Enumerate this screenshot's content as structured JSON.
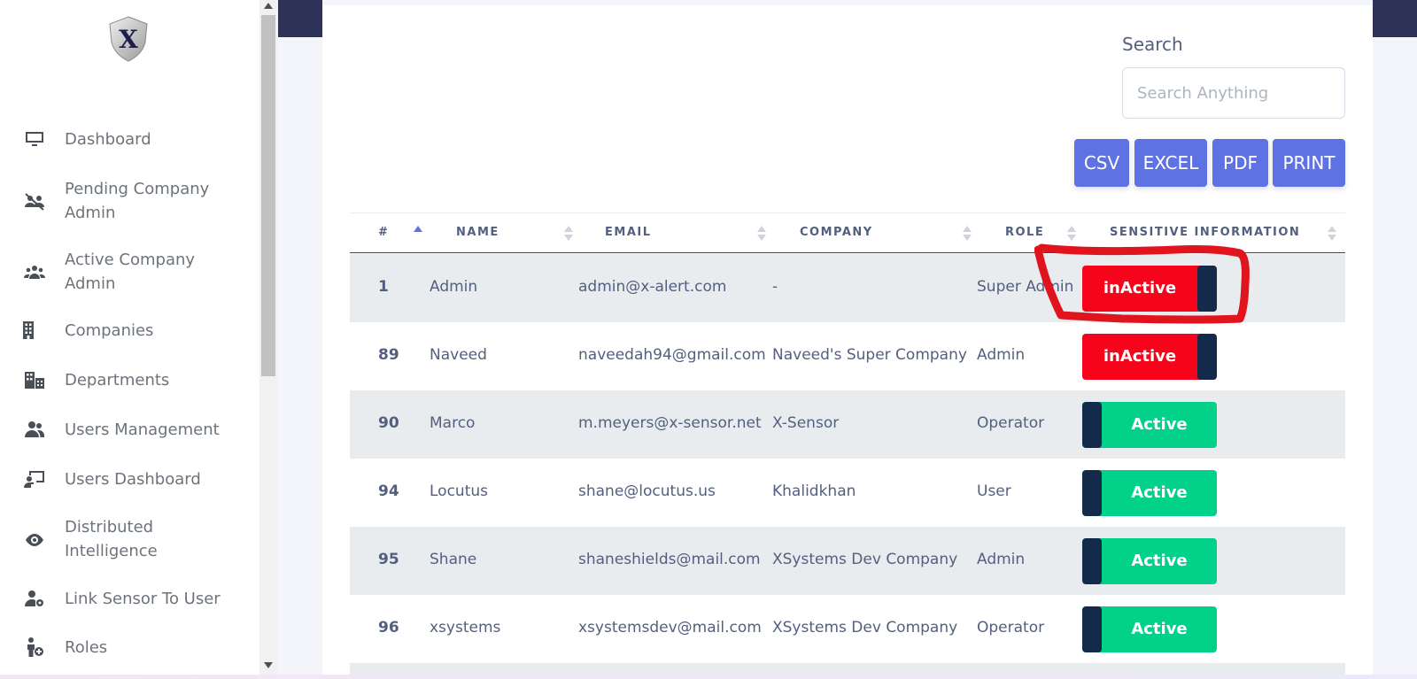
{
  "sidebar": {
    "logo_letter": "X",
    "items": [
      {
        "label": "Dashboard",
        "icon": "monitor-icon"
      },
      {
        "label": "Pending Company Admin",
        "icon": "users-slash-icon"
      },
      {
        "label": "Active Company Admin",
        "icon": "users-group-icon"
      },
      {
        "label": "Companies",
        "icon": "building-icon"
      },
      {
        "label": "Departments",
        "icon": "departments-icon"
      },
      {
        "label": "Users Management",
        "icon": "user-friends-icon"
      },
      {
        "label": "Users Dashboard",
        "icon": "chalkboard-user-icon"
      },
      {
        "label": "Distributed Intelligence",
        "icon": "eye-icon"
      },
      {
        "label": "Link Sensor To User",
        "icon": "user-cog-icon"
      },
      {
        "label": "Roles",
        "icon": "user-plus-icon"
      }
    ]
  },
  "search": {
    "label": "Search",
    "placeholder": "Search Anything",
    "value": ""
  },
  "export_buttons": [
    "CSV",
    "EXCEL",
    "PDF",
    "PRINT"
  ],
  "table": {
    "headers": [
      "#",
      "NAME",
      "EMAIL",
      "COMPANY",
      "ROLE",
      "SENSITIVE INFORMATION"
    ],
    "rows": [
      {
        "id": "1",
        "name": "Admin",
        "email": "admin@x-alert.com",
        "company": "-",
        "role": "Super Admin",
        "status": "inActive",
        "active": false
      },
      {
        "id": "89",
        "name": "Naveed",
        "email": "naveedah94@gmail.com",
        "company": "Naveed's Super Company",
        "role": "Admin",
        "status": "inActive",
        "active": false
      },
      {
        "id": "90",
        "name": "Marco",
        "email": "m.meyers@x-sensor.net",
        "company": "X-Sensor",
        "role": "Operator",
        "status": "Active",
        "active": true
      },
      {
        "id": "94",
        "name": "Locutus",
        "email": "shane@locutus.us",
        "company": "Khalidkhan",
        "role": "User",
        "status": "Active",
        "active": true
      },
      {
        "id": "95",
        "name": "Shane",
        "email": "shaneshields@mail.com",
        "company": "XSystems Dev Company",
        "role": "Admin",
        "status": "Active",
        "active": true
      },
      {
        "id": "96",
        "name": "xsystems",
        "email": "xsystemsdev@mail.com",
        "company": "XSystems Dev Company",
        "role": "Operator",
        "status": "Active",
        "active": true
      }
    ]
  },
  "colors": {
    "accent": "#5e72e4",
    "inactive": "#f5041c",
    "active": "#02d18a",
    "knob": "#142a4a",
    "annotation": "#e0141c",
    "header_band": "#2f3258"
  }
}
